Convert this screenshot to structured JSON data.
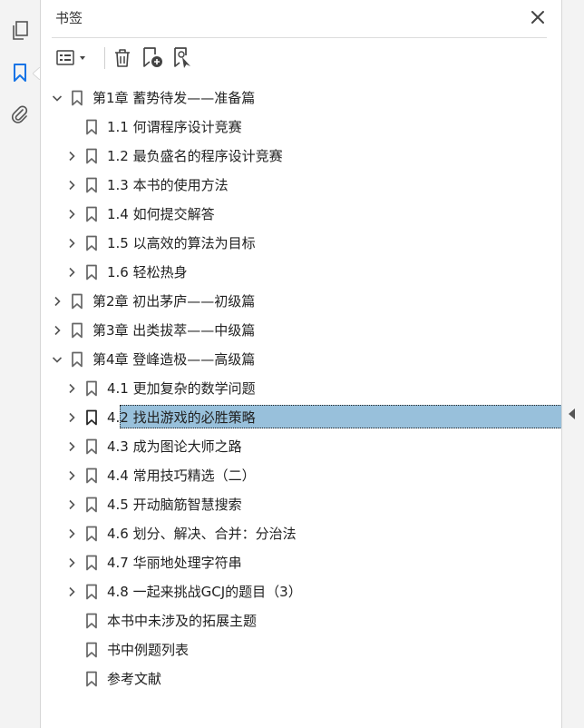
{
  "panel": {
    "title": "书签"
  },
  "tree": [
    {
      "level": 0,
      "expandable": true,
      "expanded": true,
      "label": "第1章 蓄势待发——准备篇"
    },
    {
      "level": 1,
      "expandable": false,
      "expanded": false,
      "label": "1.1 何谓程序设计竞赛"
    },
    {
      "level": 1,
      "expandable": true,
      "expanded": false,
      "label": "1.2 最负盛名的程序设计竞赛"
    },
    {
      "level": 1,
      "expandable": true,
      "expanded": false,
      "label": "1.3 本书的使用方法"
    },
    {
      "level": 1,
      "expandable": true,
      "expanded": false,
      "label": "1.4 如何提交解答"
    },
    {
      "level": 1,
      "expandable": true,
      "expanded": false,
      "label": "1.5 以高效的算法为目标"
    },
    {
      "level": 1,
      "expandable": true,
      "expanded": false,
      "label": "1.6 轻松热身"
    },
    {
      "level": 0,
      "expandable": true,
      "expanded": false,
      "label": "第2章 初出茅庐——初级篇"
    },
    {
      "level": 0,
      "expandable": true,
      "expanded": false,
      "label": "第3章 出类拔萃——中级篇"
    },
    {
      "level": 0,
      "expandable": true,
      "expanded": true,
      "label": "第4章 登峰造极——高级篇"
    },
    {
      "level": 1,
      "expandable": true,
      "expanded": false,
      "label": "4.1 更加复杂的数学问题"
    },
    {
      "level": 1,
      "expandable": true,
      "expanded": false,
      "label": "4.2 找出游戏的必胜策略",
      "selected": true
    },
    {
      "level": 1,
      "expandable": true,
      "expanded": false,
      "label": "4.3 成为图论大师之路"
    },
    {
      "level": 1,
      "expandable": true,
      "expanded": false,
      "label": "4.4 常用技巧精选（二）"
    },
    {
      "level": 1,
      "expandable": true,
      "expanded": false,
      "label": "4.5 开动脑筋智慧搜索"
    },
    {
      "level": 1,
      "expandable": true,
      "expanded": false,
      "label": "4.6 划分、解决、合并：分治法"
    },
    {
      "level": 1,
      "expandable": true,
      "expanded": false,
      "label": "4.7 华丽地处理字符串"
    },
    {
      "level": 1,
      "expandable": true,
      "expanded": false,
      "label": "4.8 一起来挑战GCJ的题目（3）"
    },
    {
      "level": 1,
      "expandable": false,
      "expanded": false,
      "label": "本书中未涉及的拓展主题"
    },
    {
      "level": 1,
      "expandable": false,
      "expanded": false,
      "label": "书中例题列表"
    },
    {
      "level": 1,
      "expandable": false,
      "expanded": false,
      "label": "参考文献"
    }
  ],
  "icons": {
    "pages": "pages-icon",
    "bookmarks": "bookmark-panel-icon",
    "attachments": "paperclip-icon",
    "options": "options-list-icon",
    "delete": "trash-icon",
    "new_bookmark": "new-bookmark-icon",
    "new_from_selection": "bookmark-from-selection-icon",
    "close": "close-icon"
  },
  "colors": {
    "accent": "#1473e6",
    "selection": "#98c0db",
    "icon": "#555555"
  }
}
